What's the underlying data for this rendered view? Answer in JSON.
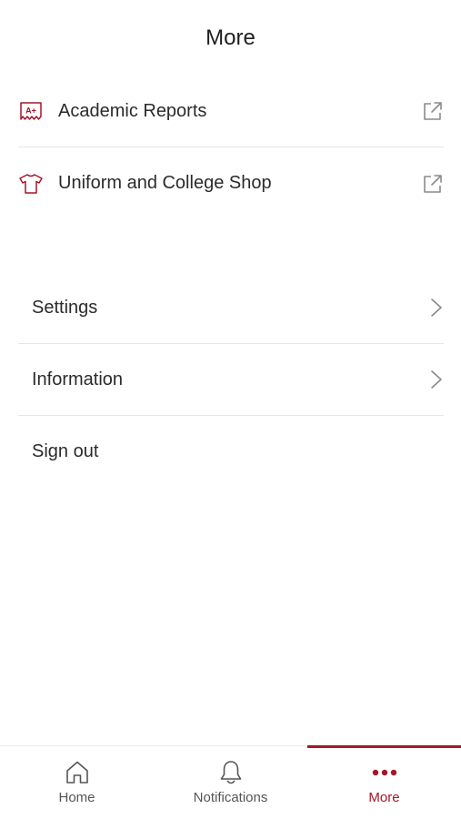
{
  "header": {
    "title": "More"
  },
  "links": [
    {
      "label": "Academic Reports",
      "icon": "report-card-icon",
      "trailing_icon": "external-link-icon"
    },
    {
      "label": "Uniform and College Shop",
      "icon": "tshirt-icon",
      "trailing_icon": "external-link-icon"
    }
  ],
  "settings": [
    {
      "label": "Settings",
      "trailing_icon": "chevron-right-icon"
    },
    {
      "label": "Information",
      "trailing_icon": "chevron-right-icon"
    },
    {
      "label": "Sign out"
    }
  ],
  "tabs": [
    {
      "label": "Home",
      "icon": "home-icon",
      "active": false
    },
    {
      "label": "Notifications",
      "icon": "bell-icon",
      "active": false
    },
    {
      "label": "More",
      "icon": "more-dots-icon",
      "active": true
    }
  ],
  "colors": {
    "accent": "#a3172a",
    "text": "#2b2b2b",
    "muted": "#555555",
    "divider": "#e6e6e6"
  }
}
